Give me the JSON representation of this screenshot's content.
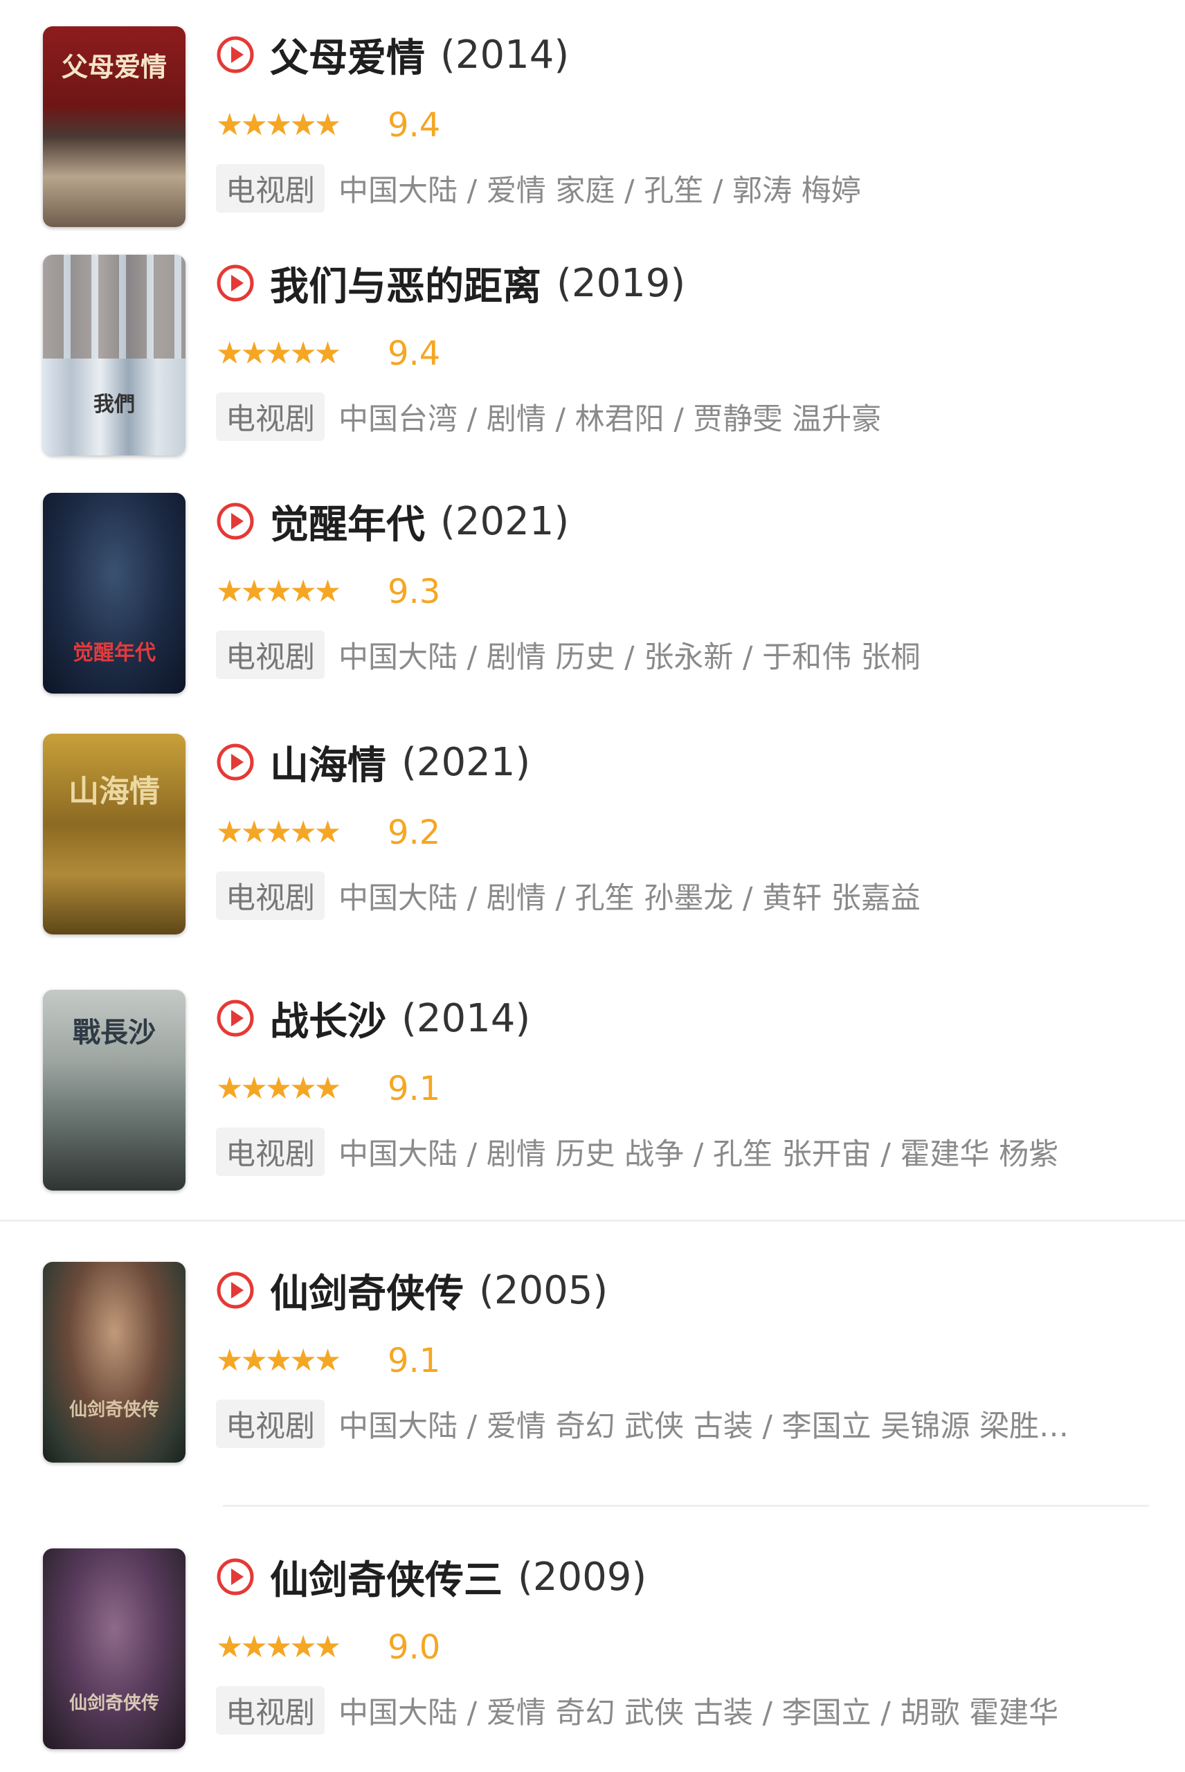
{
  "accent_color": "#f5a623",
  "play_icon_color": "#e53935",
  "items": [
    {
      "title": "父母爱情",
      "year": "(2014)",
      "score": "9.4",
      "rating": 0.9,
      "tag": "电视剧",
      "meta": "中国大陆 / 爱情 家庭 / 孔笙 / 郭涛 梅婷",
      "poster_text": "父母爱情"
    },
    {
      "title": "我们与恶的距离",
      "year": "(2019)",
      "score": "9.4",
      "rating": 0.9,
      "tag": "电视剧",
      "meta": "中国台湾 / 剧情 / 林君阳 / 贾静雯 温升豪",
      "poster_text": "我們"
    },
    {
      "title": "觉醒年代",
      "year": "(2021)",
      "score": "9.3",
      "rating": 0.9,
      "tag": "电视剧",
      "meta": "中国大陆 / 剧情 历史 / 张永新 / 于和伟 张桐",
      "poster_text": "觉醒年代"
    },
    {
      "title": "山海情",
      "year": "(2021)",
      "score": "9.2",
      "rating": 0.9,
      "tag": "电视剧",
      "meta": "中国大陆 / 剧情 / 孔笙 孙墨龙 / 黄轩 张嘉益",
      "poster_text": "山海情"
    },
    {
      "title": "战长沙",
      "year": "(2014)",
      "score": "9.1",
      "rating": 0.9,
      "tag": "电视剧",
      "meta": "中国大陆 / 剧情 历史 战争 / 孔笙 张开宙 / 霍建华 杨紫",
      "poster_text": "戰長沙"
    },
    {
      "title": "仙剑奇侠传",
      "year": "(2005)",
      "score": "9.1",
      "rating": 0.9,
      "tag": "电视剧",
      "meta": "中国大陆 / 爱情 奇幻 武侠 古装 / 李国立 吴锦源 梁胜…",
      "poster_text": "仙剑奇侠传"
    },
    {
      "title": "仙剑奇侠传三",
      "year": "(2009)",
      "score": "9.0",
      "rating": 0.9,
      "tag": "电视剧",
      "meta": "中国大陆 / 爱情 奇幻 武侠 古装 / 李国立 / 胡歌 霍建华",
      "poster_text": "仙剑奇侠传"
    }
  ]
}
